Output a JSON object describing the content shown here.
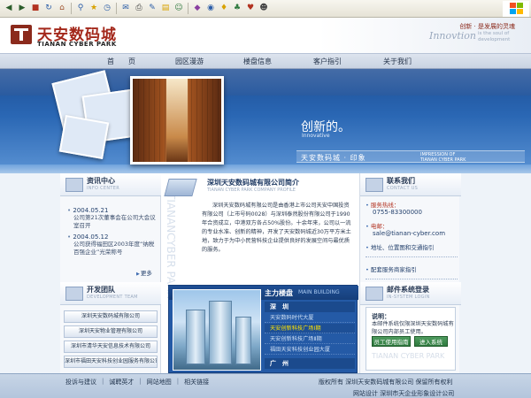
{
  "browser_toolbar": {
    "icons": [
      "back-icon",
      "forward-icon",
      "stop-icon",
      "refresh-icon",
      "home-icon",
      "search-icon",
      "favorites-icon",
      "history-icon",
      "mail-icon",
      "print-icon",
      "edit-icon",
      "discuss-icon",
      "messenger-icon",
      "research-icon",
      "toolbar-extra-icon"
    ]
  },
  "header": {
    "logo_cn": "天安数码城",
    "logo_en": "TIANAN CYBER PARK",
    "slogan_cn": "创新 · 是发展的灵魂",
    "slogan_en_main": "Innovtion",
    "slogan_en_sub": "is the soul of development"
  },
  "nav": {
    "items": [
      {
        "label": "首　　页"
      },
      {
        "label": "园区漫游"
      },
      {
        "label": "楼盘信息"
      },
      {
        "label": "客户指引"
      },
      {
        "label": "关于我们"
      }
    ]
  },
  "hero": {
    "tagline_cn": "创新的。",
    "tagline_en": "Innovative",
    "brand_cn": "天安数码城 · 印象",
    "brand_en_line1": "IMPRESSION OF",
    "brand_en_line2": "TIANAN CYBER PARK"
  },
  "news": {
    "title": "资讯中心",
    "subtitle": "INFO CENTER",
    "items": [
      {
        "date": "2004.05.21",
        "text": "公司第21次董事会在公司大会议室召开"
      },
      {
        "date": "2004.05.12",
        "text": "公司获得福田区2003年度“纳税百强企业”光荣称号"
      }
    ],
    "more": "更多"
  },
  "team": {
    "title": "开发团队",
    "subtitle": "DEVELOPMENT TEAM",
    "items": [
      {
        "label": "深圳天安数码城有限公司"
      },
      {
        "label": "深圳天安物业管理有限公司"
      },
      {
        "label": "深圳市清华天安信息技术有限公司"
      },
      {
        "label": "深圳市福田天安科技创业园服务有限公司"
      }
    ]
  },
  "profile": {
    "title": "深圳天安数码城有限公司简介",
    "subtitle": "TIANAN CYBER PARK COMPANY PROFILE",
    "watermark": [
      "TIANAN",
      "CYBER PARK"
    ],
    "text": "深圳天安数码城有限公司是由香港上市公司天安中国投资有限公司（上市号码0028）与深圳泰然股份有限公司于1990年合资成立，中港双方各占50%股份。十余年来，公司以一流的专业水准、创新的精神，开发了天安数码城近30万平方米土地，致力于为中小民营科技企业提供良好的发展空间与最优质的服务。",
    "detail": "详细"
  },
  "main_building": {
    "title": "主力楼盘",
    "title_en": "MAIN BUILDING",
    "city_shenzhen": "深　圳",
    "items": [
      {
        "label": "天安数码时代大厦"
      },
      {
        "label": "天安创新科技广场Ⅰ期"
      },
      {
        "label": "天安创新科技广场Ⅱ期"
      },
      {
        "label": "福田天安科技创业园大厦"
      }
    ],
    "city_guangzhou": "广　州",
    "active_index": 1
  },
  "contact": {
    "title": "联系我们",
    "subtitle": "CONTACT US",
    "hotline_label": "服务热线：",
    "hotline": "0755-83300000",
    "email_label": "电邮：",
    "email": "sale@tianan-cyber.com",
    "map_link": "地址、位置图和交通指引",
    "business_link": "配套服务商家指引"
  },
  "login": {
    "title": "邮件系统登录",
    "subtitle": "IN-SYSTEM LOGIN",
    "label": "说明：",
    "desc": "本邮件系统仅限深圳天安数码城有限公司内部员工使用。",
    "guide_button": "员工使用指南",
    "enter_button": "进入系统",
    "watermark": "TIANAN CYBER PARK"
  },
  "footer": {
    "links": [
      {
        "label": "投诉与建议"
      },
      {
        "label": "诚聘英才"
      },
      {
        "label": "网站地图"
      },
      {
        "label": "相关链接"
      }
    ],
    "copyright": "版权所有  深圳天安数码城有限公司  保留所有权利",
    "design_credit": "网站设计  深圳市天企业形象设计公司"
  }
}
